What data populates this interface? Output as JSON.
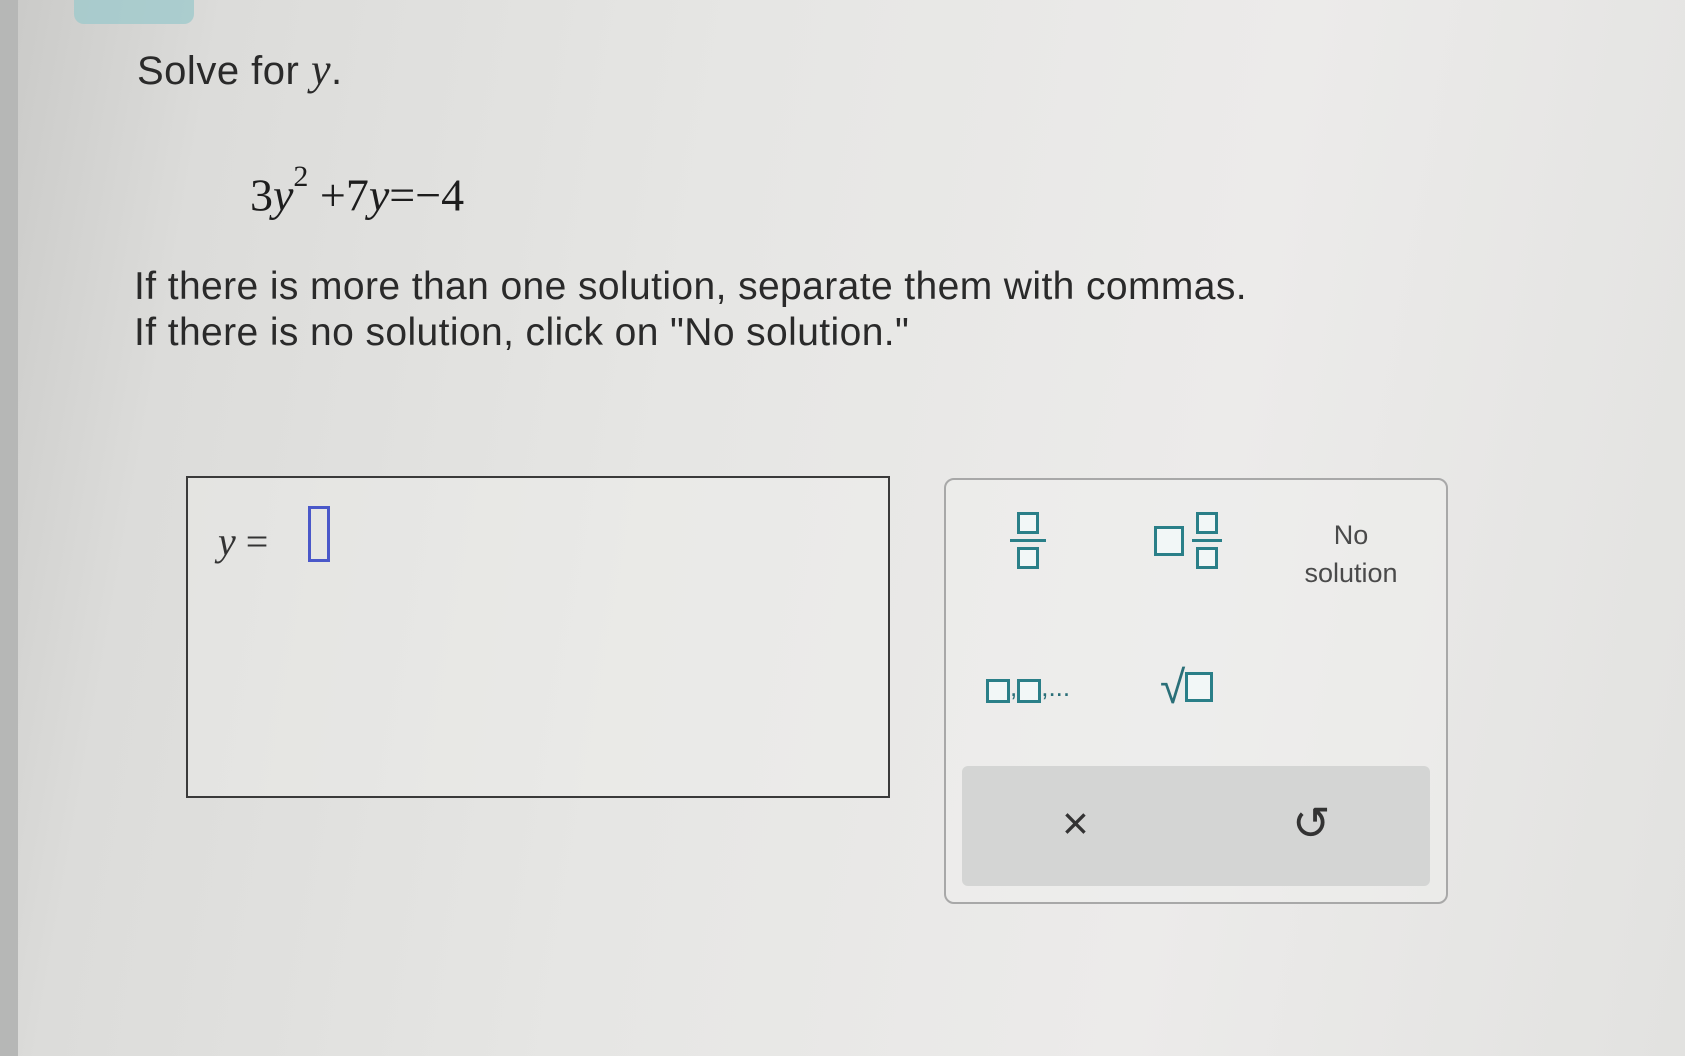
{
  "problem": {
    "prompt": "Solve for",
    "variable": "y",
    "period": ".",
    "equation": {
      "lhs_coef": "3",
      "lhs_var": "y",
      "exponent": "2",
      "middle": "+7",
      "middle_var": "y",
      "rhs": "=−4"
    },
    "instruction_line1": "If there is more than one solution, separate them with commas.",
    "instruction_line2": "If there is no solution, click on \"No solution.\""
  },
  "answer": {
    "label_var": "y",
    "label_eq": " = ",
    "value": ""
  },
  "palette": {
    "no_solution_line1": "No",
    "no_solution_line2": "solution",
    "list_suffix": ",...",
    "list_comma": ",",
    "sqrt_symbol": "√",
    "clear_icon": "×",
    "undo_icon": "↺"
  },
  "colors": {
    "accent": "#2a7f88",
    "cursor": "#4a58c9"
  }
}
